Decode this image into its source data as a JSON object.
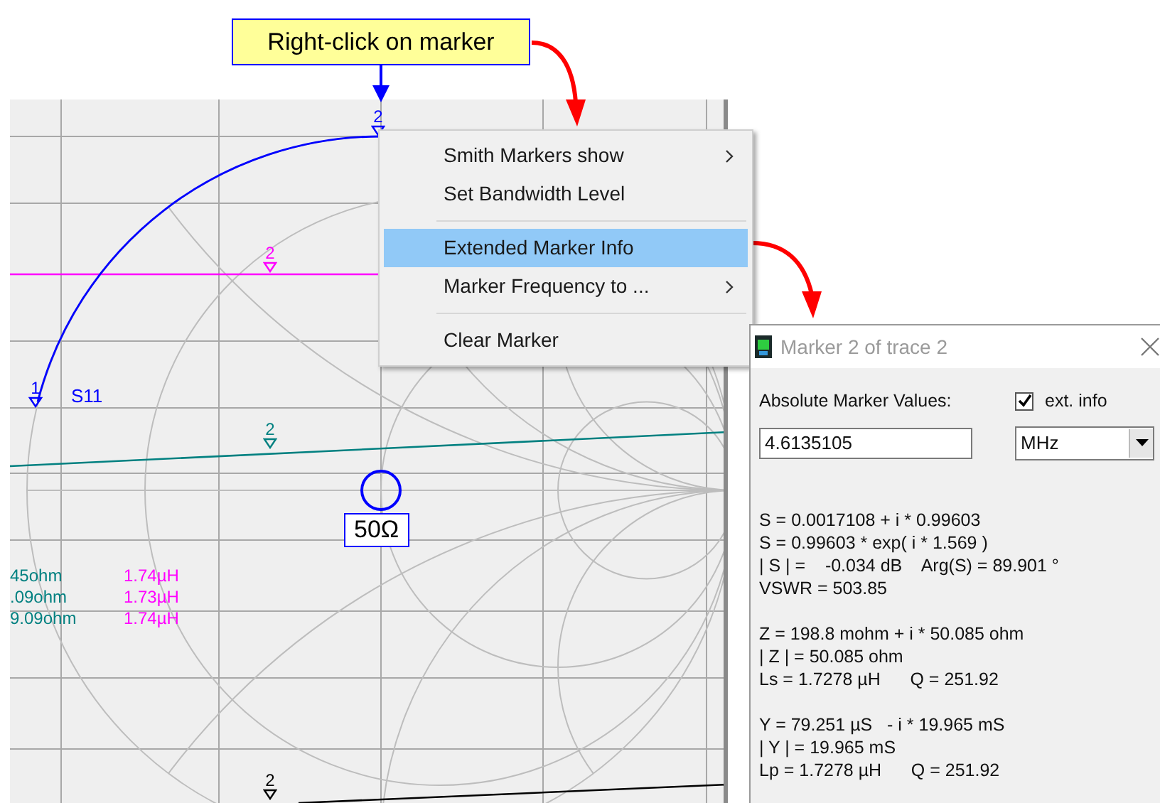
{
  "callout": {
    "text": "Right-click on marker"
  },
  "plot": {
    "trace_label": "S11",
    "markers": [
      {
        "label": "2",
        "color": "#0000ff"
      },
      {
        "label": "2",
        "color": "#ff00ff"
      },
      {
        "label": "2",
        "color": "#008080"
      },
      {
        "label": "2",
        "color": "#000000"
      },
      {
        "label": "1",
        "color": "#0000ff"
      }
    ],
    "center_label": "50Ω",
    "readouts": [
      {
        "resistance": "45ohm",
        "inductance": "1.74µH"
      },
      {
        "resistance": ".09ohm",
        "inductance": "1.73µH"
      },
      {
        "resistance": "9.09ohm",
        "inductance": "1.74µH"
      }
    ]
  },
  "context_menu": {
    "items": [
      {
        "kind": "item",
        "label": "Smith Markers show",
        "submenu": true,
        "selected": false
      },
      {
        "kind": "item",
        "label": "Set Bandwidth Level",
        "submenu": false,
        "selected": false
      },
      {
        "kind": "separator"
      },
      {
        "kind": "item",
        "label": "Extended Marker Info",
        "submenu": false,
        "selected": true
      },
      {
        "kind": "item",
        "label": "Marker Frequency to ...",
        "submenu": true,
        "selected": false
      },
      {
        "kind": "separator"
      },
      {
        "kind": "item",
        "label": "Clear Marker",
        "submenu": false,
        "selected": false
      }
    ]
  },
  "dialog": {
    "title": "Marker 2 of trace 2",
    "values_label": "Absolute Marker Values:",
    "ext_info": {
      "label": "ext. info",
      "checked": true
    },
    "frequency": {
      "value": "4.6135105"
    },
    "unit": {
      "value": "MHz"
    },
    "groups": [
      [
        "S = 0.0017108 + i * 0.99603",
        "S = 0.99603 * exp( i * 1.569 )",
        "| S | =    -0.034 dB    Arg(S) = 89.901 °",
        "VSWR = 503.85"
      ],
      [
        "Z = 198.8 mohm + i * 50.085 ohm",
        "| Z | = 50.085 ohm",
        "Ls = 1.7278 µH      Q = 251.92"
      ],
      [
        "Y = 79.251 µS   - i * 19.965 mS",
        "| Y | = 19.965 mS",
        "Lp = 1.7278 µH      Q = 251.92"
      ]
    ]
  }
}
